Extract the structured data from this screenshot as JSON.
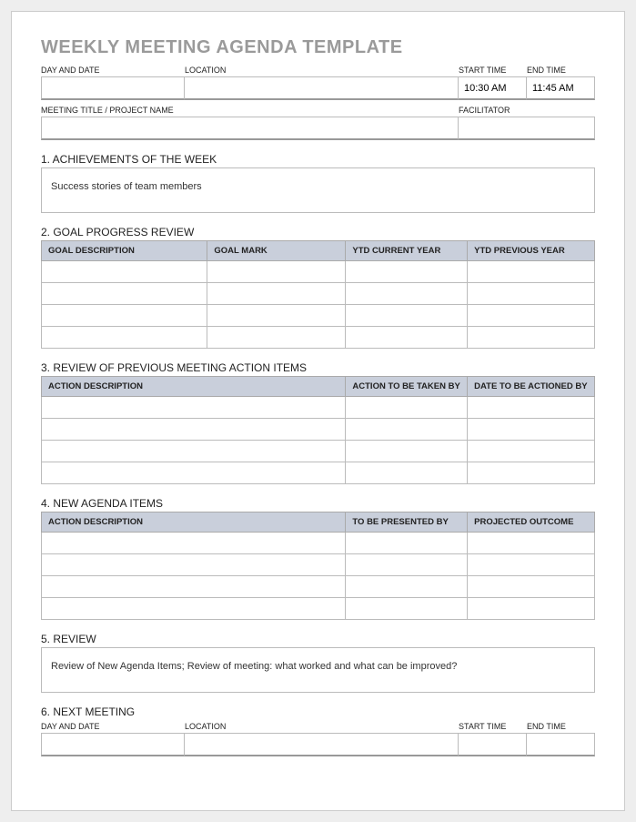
{
  "title": "WEEKLY MEETING AGENDA TEMPLATE",
  "meta1": {
    "day_date_label": "DAY AND DATE",
    "day_date_value": "",
    "location_label": "LOCATION",
    "location_value": "",
    "start_time_label": "START TIME",
    "start_time_value": "10:30 AM",
    "end_time_label": "END TIME",
    "end_time_value": "11:45 AM"
  },
  "meta2": {
    "title_label": "MEETING TITLE / PROJECT NAME",
    "title_value": "",
    "facilitator_label": "FACILITATOR",
    "facilitator_value": ""
  },
  "s1": {
    "heading": "1. ACHIEVEMENTS OF THE WEEK",
    "text": "Success stories of team members"
  },
  "s2": {
    "heading": "2. GOAL PROGRESS REVIEW",
    "h1": "GOAL DESCRIPTION",
    "h2": "GOAL MARK",
    "h3": "YTD CURRENT YEAR",
    "h4": "YTD PREVIOUS YEAR"
  },
  "s3": {
    "heading": "3. REVIEW OF PREVIOUS MEETING ACTION ITEMS",
    "h1": "ACTION DESCRIPTION",
    "h2": "ACTION TO BE TAKEN BY",
    "h3": "DATE TO BE ACTIONED BY"
  },
  "s4": {
    "heading": "4. NEW AGENDA ITEMS",
    "h1": "ACTION DESCRIPTION",
    "h2": "TO BE PRESENTED BY",
    "h3": "PROJECTED OUTCOME"
  },
  "s5": {
    "heading": "5. REVIEW",
    "text": "Review of New Agenda Items; Review of meeting: what worked and what can be improved?"
  },
  "s6": {
    "heading": "6. NEXT MEETING",
    "day_date_label": "DAY AND DATE",
    "day_date_value": "",
    "location_label": "LOCATION",
    "location_value": "",
    "start_time_label": "START TIME",
    "start_time_value": "",
    "end_time_label": "END TIME",
    "end_time_value": ""
  }
}
